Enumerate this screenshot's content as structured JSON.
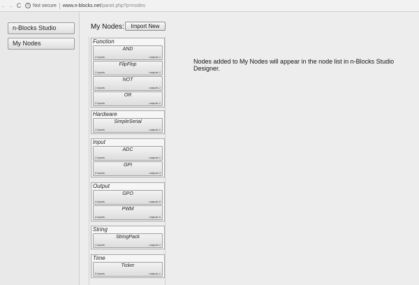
{
  "browser": {
    "back": "←",
    "forward": "→",
    "reload": "C",
    "security": "Not secure",
    "url_host": "www.n-blocks.net",
    "url_path": "/panel.php?p=nodes"
  },
  "nav": {
    "studio": "n-Blocks Studio",
    "my_nodes": "My Nodes"
  },
  "main": {
    "label": "My Nodes:",
    "import_button": "Import New",
    "info": "Nodes added to My Nodes will appear in the node list in n-Blocks Studio Designer."
  },
  "categories": [
    {
      "title": "Function",
      "nodes": [
        {
          "name": "AND",
          "in": "2 inputs",
          "out": "outputs 1"
        },
        {
          "name": "FlipFlop",
          "in": "1 inputs",
          "out": "outputs 1"
        },
        {
          "name": "NOT",
          "in": "1 inputs",
          "out": "outputs 1"
        },
        {
          "name": "OR",
          "in": "2 inputs",
          "out": "outputs 1"
        }
      ]
    },
    {
      "title": "Hardware",
      "nodes": [
        {
          "name": "SimpleSerial",
          "in": "1 inputs",
          "out": "outputs 1"
        }
      ]
    },
    {
      "title": "Input",
      "nodes": [
        {
          "name": "ADC",
          "in": "1 inputs",
          "out": "outputs 1"
        },
        {
          "name": "GPI",
          "in": "0 inputs",
          "out": "outputs 3"
        }
      ]
    },
    {
      "title": "Output",
      "nodes": [
        {
          "name": "GPO",
          "in": "4 inputs",
          "out": "outputs 0"
        },
        {
          "name": "PWM",
          "in": "4 inputs",
          "out": "outputs 0"
        }
      ]
    },
    {
      "title": "String",
      "nodes": [
        {
          "name": "StringPack",
          "in": "1 inputs",
          "out": "outputs 1"
        }
      ]
    },
    {
      "title": "Time",
      "nodes": [
        {
          "name": "Ticker",
          "in": "0 inputs",
          "out": "outputs 1"
        }
      ]
    }
  ]
}
